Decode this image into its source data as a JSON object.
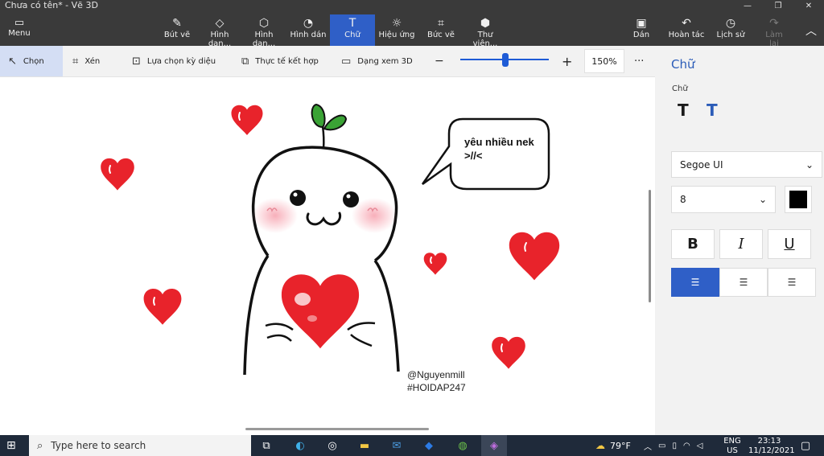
{
  "window": {
    "title": "Chưa có tên* - Vẽ 3D"
  },
  "ribbon": {
    "menu_label": "Menu",
    "brushes": "Bút vẽ",
    "shapes2d": "Hình dạn...",
    "shapes3d": "Hình dạn...",
    "stickers": "Hình dán",
    "text": "Chữ",
    "effects": "Hiệu ứng",
    "canvas": "Bức vẽ",
    "library": "Thư viện...",
    "paste": "Dán",
    "undo": "Hoàn tác",
    "history": "Lịch sử",
    "redo": "Làm lại"
  },
  "toolbar": {
    "select": "Chọn",
    "crop": "Xén",
    "magic_select": "Lựa chọn kỳ diệu",
    "mixed_reality": "Thực tế kết hợp",
    "view3d": "Dạng xem 3D",
    "zoom_level": "150%",
    "zoom_fraction": 0.5,
    "more": "···"
  },
  "canvas": {
    "speech_line1": "yêu nhiều nek",
    "speech_line2": ">//<",
    "credit": "@Nguyenmill",
    "tag": "#HOIDAP247"
  },
  "panel": {
    "title": "Chữ",
    "section_label": "Chữ",
    "font": "Segoe UI",
    "size": "8",
    "text_color": "#000000",
    "bold": "B",
    "italic": "I",
    "underline": "U"
  },
  "taskbar": {
    "search_placeholder": "Type here to search",
    "weather": "79°F",
    "lang1": "ENG",
    "lang2": "US",
    "time": "23:13",
    "date": "11/12/2021"
  },
  "colors": {
    "accent": "#2f5fc7",
    "ribbon_bg": "#3a3a3a",
    "heart": "#e8232b",
    "taskbar": "#1f2a3a"
  }
}
